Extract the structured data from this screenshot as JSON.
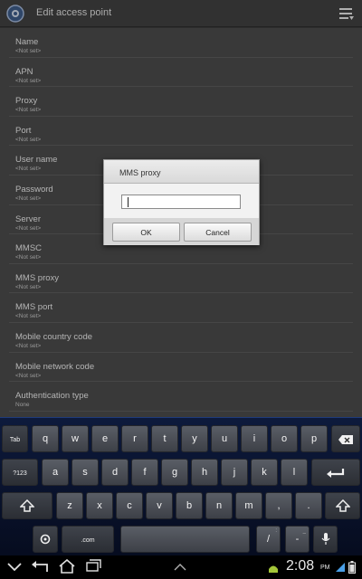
{
  "actionbar": {
    "title": "Edit access point",
    "icon": "settings-gear-icon",
    "menu_icon": "menu-icon"
  },
  "fields": [
    {
      "label": "Name",
      "value": "<Not set>"
    },
    {
      "label": "APN",
      "value": "<Not set>"
    },
    {
      "label": "Proxy",
      "value": "<Not set>"
    },
    {
      "label": "Port",
      "value": "<Not set>"
    },
    {
      "label": "User name",
      "value": "<Not set>"
    },
    {
      "label": "Password",
      "value": "<Not set>"
    },
    {
      "label": "Server",
      "value": "<Not set>"
    },
    {
      "label": "MMSC",
      "value": "<Not set>"
    },
    {
      "label": "MMS proxy",
      "value": "<Not set>"
    },
    {
      "label": "MMS port",
      "value": "<Not set>"
    },
    {
      "label": "Mobile country code",
      "value": "<Not set>"
    },
    {
      "label": "Mobile network code",
      "value": "<Not set>"
    },
    {
      "label": "Authentication type",
      "value": "None"
    }
  ],
  "dialog": {
    "title": "MMS proxy",
    "value": "",
    "ok": "OK",
    "cancel": "Cancel"
  },
  "keyboard": {
    "tab": "Tab",
    "sym": "?123",
    "com": ".com",
    "row1": [
      "q",
      "w",
      "e",
      "r",
      "t",
      "y",
      "u",
      "i",
      "o",
      "p"
    ],
    "row2": [
      "a",
      "s",
      "d",
      "f",
      "g",
      "h",
      "j",
      "k",
      "l"
    ],
    "row3": [
      "z",
      "x",
      "c",
      "v",
      "b",
      "n",
      "m",
      ",",
      "."
    ],
    "slash": "/",
    "dash": "-",
    "slash_sup": ":",
    "dash_sup": "_"
  },
  "status": {
    "time": "2:08",
    "ampm": "PM"
  },
  "colors": {
    "keyboard_bg": "#0d1a3c",
    "list_bg": "#4a4a4a",
    "dialog_bg": "#e7e7e7"
  }
}
